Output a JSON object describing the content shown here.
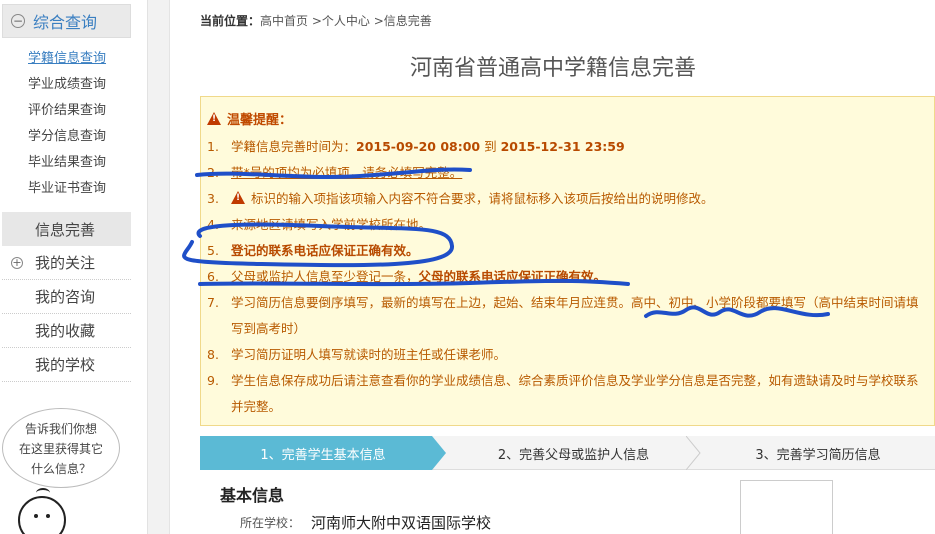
{
  "sidebar": {
    "section1": {
      "icon": "minus-circle-icon",
      "title": "综合查询"
    },
    "sublinks": [
      "学籍信息查询",
      "学业成绩查询",
      "评价结果查询",
      "学分信息查询",
      "毕业结果查询",
      "毕业证书查询"
    ],
    "info_complete": "信息完善",
    "my_follow": {
      "icon": "plus-circle-icon",
      "title": "我的关注"
    },
    "my_consult": "我的咨询",
    "my_fav": "我的收藏",
    "my_school": "我的学校",
    "bubble": [
      "告诉我们你想",
      "在这里获得其它",
      "什么信息？"
    ]
  },
  "breadcrumb": {
    "label": "当前位置：",
    "path": "高中首页 >个人中心 >信息完善"
  },
  "page_title": "河南省普通高中学籍信息完善",
  "notice": {
    "heading": "温馨提醒：",
    "items": [
      {
        "n": "1.",
        "pre": "学籍信息完善时间为：",
        "bold1": "2015-09-20 08:00",
        "mid": " 到 ",
        "bold2": "2015-12-31 23:59"
      },
      {
        "n": "2.",
        "text": "带*号的项均为必填项，请务必填写完整。"
      },
      {
        "n": "3.",
        "text": "标识的输入项指该项输入内容不符合要求，请将鼠标移入该项后按给出的说明修改。"
      },
      {
        "n": "4.",
        "text": "来源地区请填写入学前学校所在地。"
      },
      {
        "n": "5.",
        "text": "登记的联系电话应保证正确有效。"
      },
      {
        "n": "6.",
        "pre": "父母或监护人信息至少登记一条，",
        "bold": "父母的联系电话应保证正确有效。"
      },
      {
        "n": "7.",
        "text": "学习简历信息要倒序填写，最新的填写在上边，起始、结束年月应连贯。高中、初中、小学阶段都要填写（高中结束时间请填写到高考时）"
      },
      {
        "n": "8.",
        "text": "学习简历证明人填写就读时的班主任或任课老师。"
      },
      {
        "n": "9.",
        "text": "学生信息保存成功后请注意查看你的学业成绩信息、综合素质评价信息及学业学分信息是否完整，如有遗缺请及时与学校联系并完整。"
      }
    ]
  },
  "steps": [
    "1、完善学生基本信息",
    "2、完善父母或监护人信息",
    "3、完善学习简历信息"
  ],
  "basic": {
    "title": "基本信息",
    "school_label": "所在学校：",
    "school_value": "河南师大附中双语国际学校"
  },
  "colors": {
    "accent": "#3a7fc1",
    "notice_bg": "#fffbdb",
    "notice_text": "#b85a00",
    "step_active": "#5bbad5",
    "ink": "#1f4fc8"
  }
}
